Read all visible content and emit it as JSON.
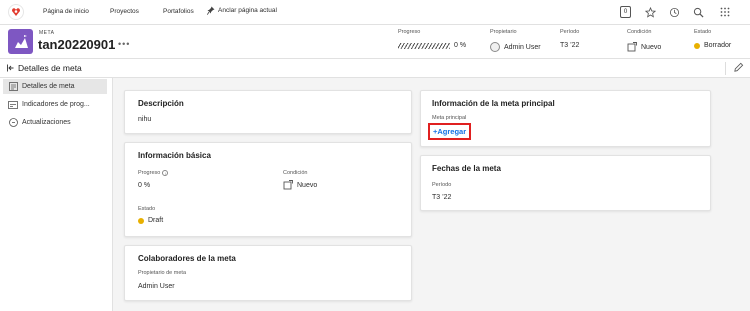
{
  "nav": {
    "links": [
      "Página de inicio",
      "Proyectos",
      "Portafolios"
    ],
    "pin_label": "Anclar página actual",
    "counter": "0",
    "icons": [
      "star-icon",
      "history-icon",
      "search-icon",
      "apps-grid-icon"
    ]
  },
  "header": {
    "object_type": "META",
    "object_name": "tan20220901",
    "more": "•••",
    "fields": {
      "progress_label": "Progreso",
      "progress_value": "0 %",
      "progress_fraction": 0,
      "owner_label": "Propietario",
      "owner_value": "Admin User",
      "period_label": "Período",
      "period_value": "T3 ’22",
      "condition_label": "Condición",
      "condition_value": "Nuevo",
      "status_label": "Estado",
      "status_value": "Borrador"
    }
  },
  "subheader": {
    "title": "Detalles de meta"
  },
  "sidebar": {
    "items": [
      {
        "label": "Detalles de meta",
        "active": true
      },
      {
        "label": "Indicadores de prog..."
      },
      {
        "label": "Actualizaciones"
      }
    ]
  },
  "cards": {
    "description": {
      "title": "Descripción",
      "text": "nihu"
    },
    "basic": {
      "title": "Información básica",
      "progress_label": "Progreso",
      "progress_value": "0 %",
      "condition_label": "Condición",
      "condition_value": "Nuevo",
      "status_label": "Estado",
      "status_value": "Draft"
    },
    "collaborators": {
      "title": "Colaboradores de la meta",
      "owner_label": "Propietario de meta",
      "owner_value": "Admin User"
    },
    "parent": {
      "title": "Información de la meta principal",
      "label": "Meta principal",
      "add": "+Agregar"
    },
    "dates": {
      "title": "Fechas de la meta",
      "period_label": "Período",
      "period_value": "T3 ’22"
    }
  },
  "colors": {
    "accent": "#1473e6",
    "goal_purple": "#7e57c2",
    "status_yellow": "#e8b000",
    "highlight_red": "#e02020"
  }
}
